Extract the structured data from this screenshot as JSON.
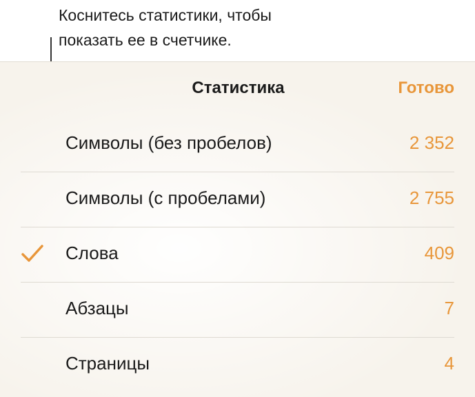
{
  "callout": {
    "line1": "Коснитесь статистики, чтобы",
    "line2": "показать ее в счетчике."
  },
  "header": {
    "title": "Статистика",
    "done_label": "Готово"
  },
  "rows": [
    {
      "label": "Символы (без пробелов)",
      "value": "2 352",
      "checked": false
    },
    {
      "label": "Символы (с пробелами)",
      "value": "2 755",
      "checked": false
    },
    {
      "label": "Слова",
      "value": "409",
      "checked": true
    },
    {
      "label": "Абзацы",
      "value": "7",
      "checked": false
    },
    {
      "label": "Страницы",
      "value": "4",
      "checked": false
    }
  ],
  "colors": {
    "accent": "#e8963a",
    "background": "#f7f3ec",
    "text": "#1a1a1a"
  },
  "icons": {
    "check": "checkmark-icon"
  }
}
